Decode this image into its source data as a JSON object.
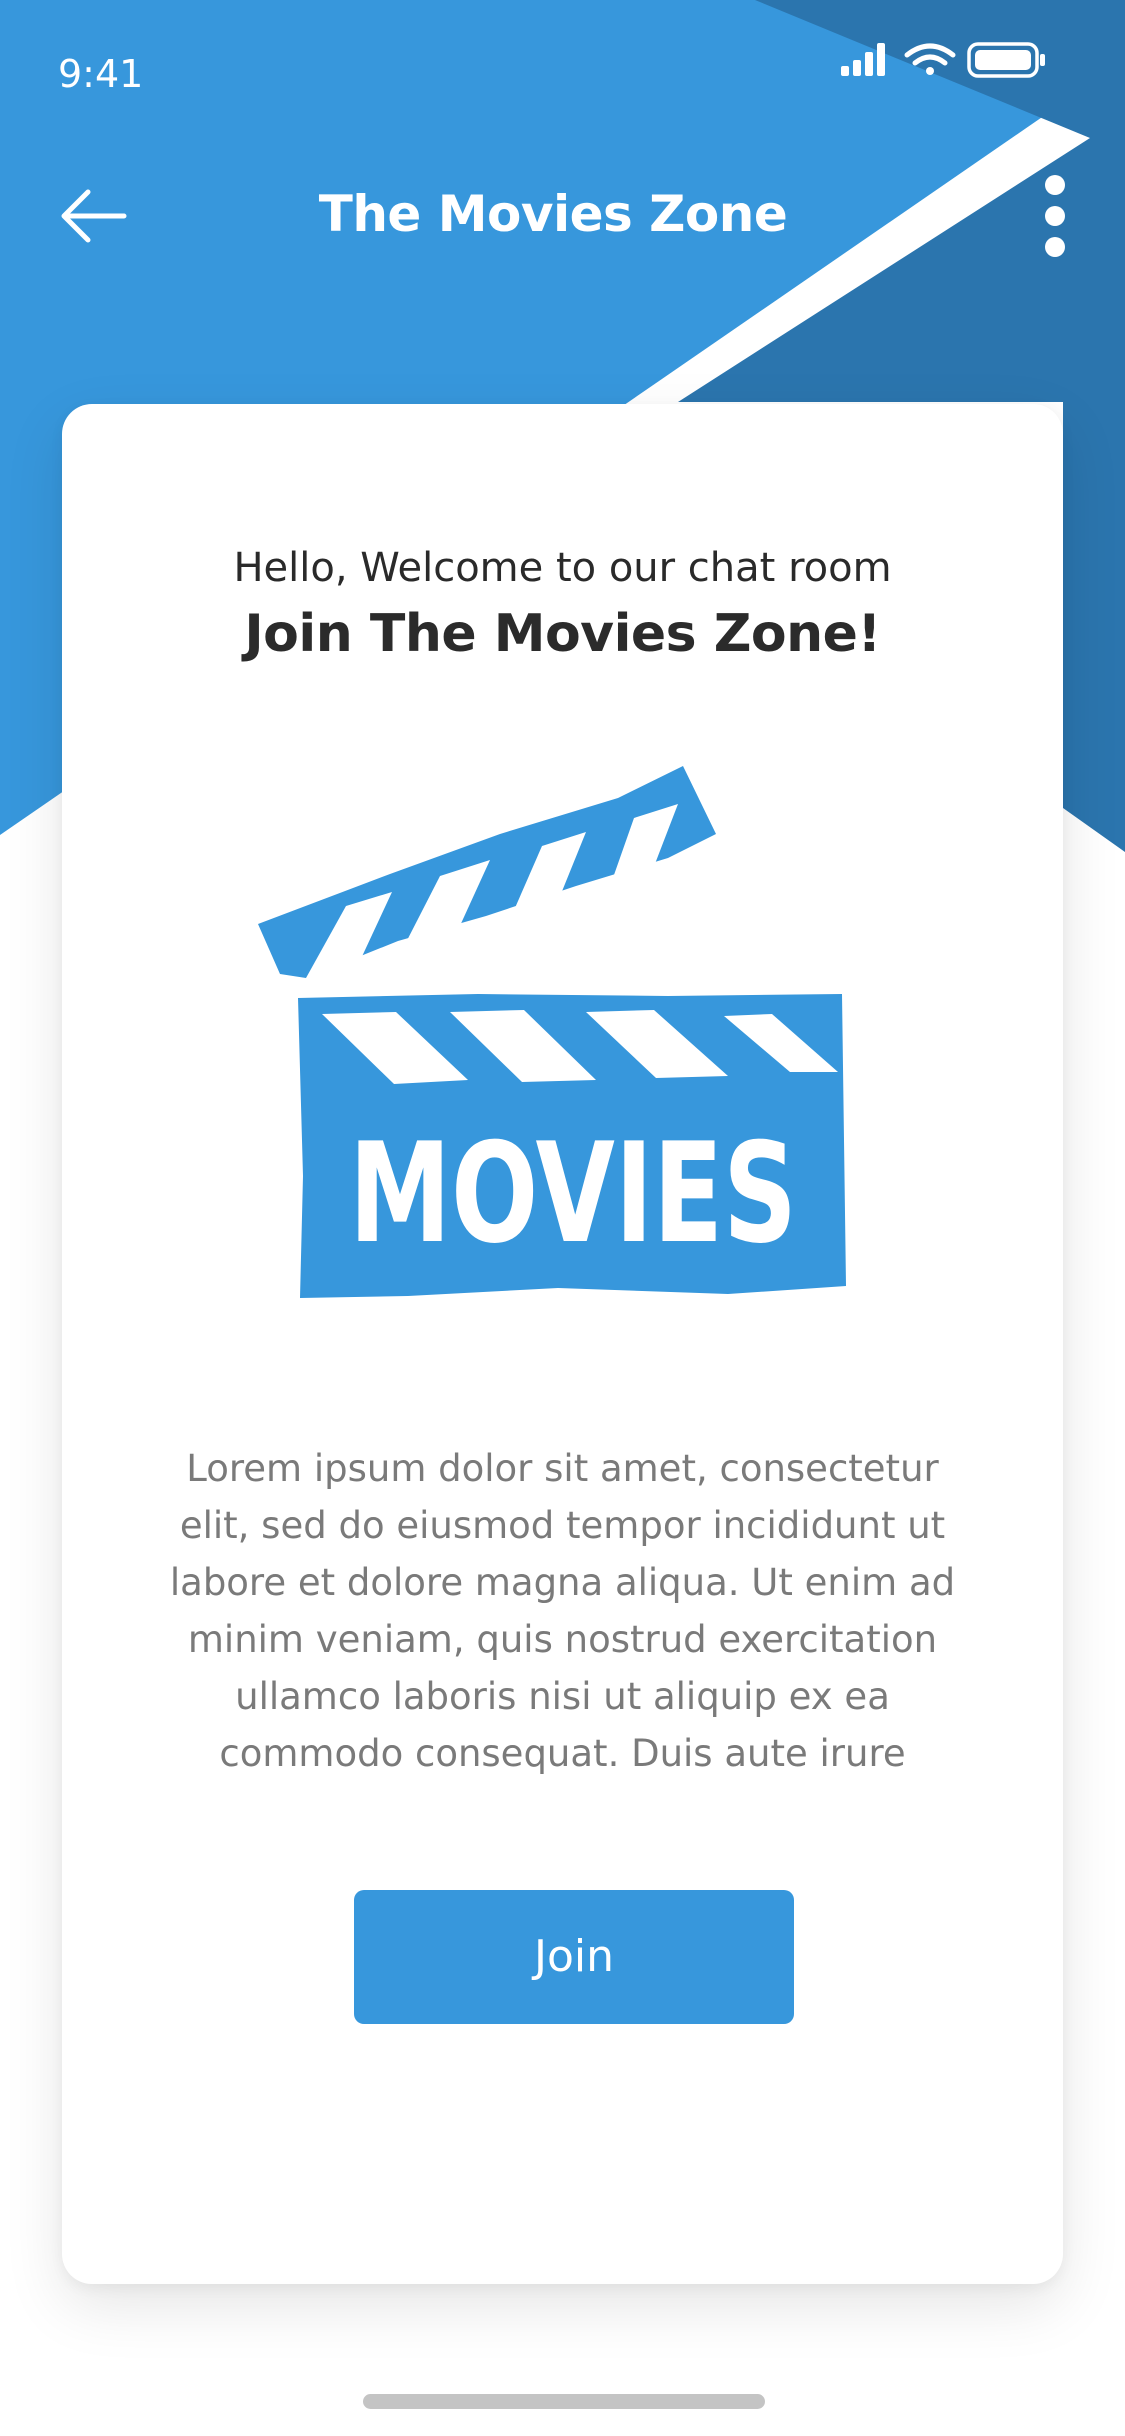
{
  "status_bar": {
    "time": "9:41",
    "icons": [
      "signal-icon",
      "wifi-icon",
      "battery-icon"
    ]
  },
  "header": {
    "title": "The Movies Zone",
    "back_icon": "arrow-left-icon",
    "menu_icon": "more-vertical-icon"
  },
  "card": {
    "greeting": "Hello, Welcome to our chat room",
    "heading": "Join The Movies Zone!",
    "illustration": {
      "icon": "clapperboard-icon",
      "text": "MOVIES"
    },
    "description": "Lorem ipsum dolor sit amet, consectetur elit, sed do eiusmod tempor incididunt ut labore et  dolore magna aliqua. Ut enim ad minim veniam,  quis nostrud exercitation ullamco laboris nisi ut  aliquip ex ea commodo consequat. Duis aute irure",
    "join_label": "Join"
  },
  "colors": {
    "primary": "#3797dc",
    "primary_dark": "#2b75ae",
    "text_dark": "#2b2b2b",
    "text_muted": "#7a7a7a",
    "card_bg": "#ffffff"
  }
}
